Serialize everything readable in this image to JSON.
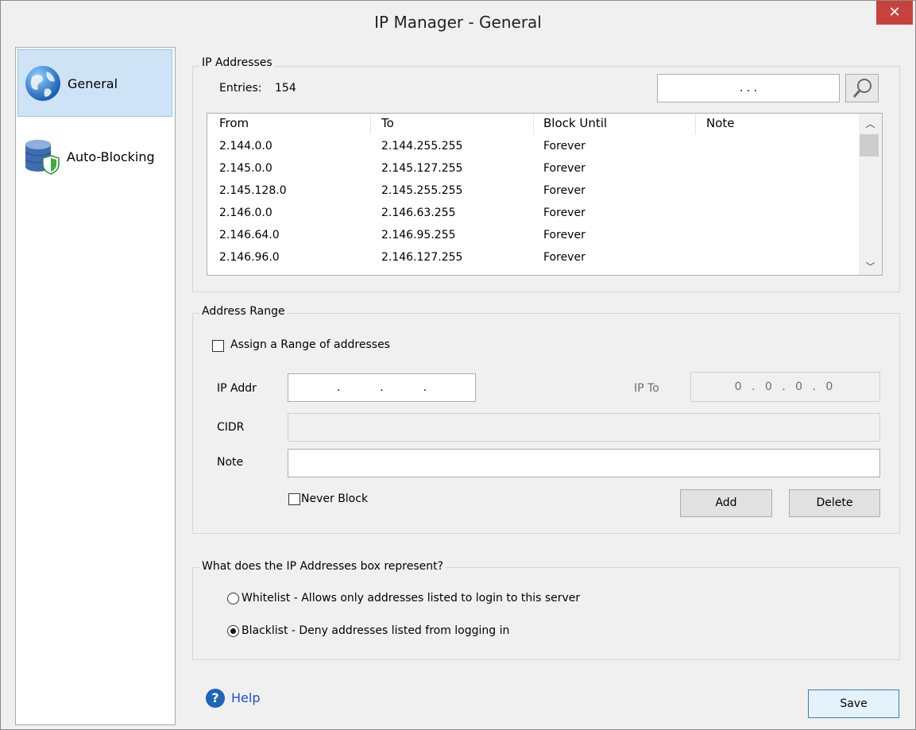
{
  "window": {
    "title": "IP Manager - General",
    "close_glyph": "✕"
  },
  "sidebar": {
    "items": [
      {
        "label": "General",
        "icon": "globe-icon",
        "active": true
      },
      {
        "label": "Auto-Blocking",
        "icon": "database-shield-icon",
        "active": false
      }
    ]
  },
  "ip_addresses": {
    "group_title": "IP Addresses",
    "entries_label": "Entries:",
    "entries_count": "154",
    "search_ip_placeholder": ". . .",
    "columns": [
      "From",
      "To",
      "Block Until",
      "Note"
    ],
    "rows": [
      {
        "from": "2.144.0.0",
        "to": "2.144.255.255",
        "until": "Forever",
        "note": ""
      },
      {
        "from": "2.145.0.0",
        "to": "2.145.127.255",
        "until": "Forever",
        "note": ""
      },
      {
        "from": "2.145.128.0",
        "to": "2.145.255.255",
        "until": "Forever",
        "note": ""
      },
      {
        "from": "2.146.0.0",
        "to": "2.146.63.255",
        "until": "Forever",
        "note": ""
      },
      {
        "from": "2.146.64.0",
        "to": "2.146.95.255",
        "until": "Forever",
        "note": ""
      },
      {
        "from": "2.146.96.0",
        "to": "2.146.127.255",
        "until": "Forever",
        "note": ""
      }
    ]
  },
  "address_range": {
    "group_title": "Address Range",
    "assign_range_label": "Assign a Range of addresses",
    "assign_range_checked": false,
    "ip_addr_label": "IP Addr",
    "ip_to_label": "IP To",
    "ip_to_value": "0 . 0 . 0 . 0",
    "cidr_label": "CIDR",
    "cidr_value": "",
    "note_label": "Note",
    "note_value": "",
    "never_block_label": "Never Block",
    "never_block_checked": false,
    "add_label": "Add",
    "delete_label": "Delete"
  },
  "representation": {
    "group_title": "What does the IP Addresses box represent?",
    "whitelist_label": "Whitelist - Allows only addresses listed to login to this server",
    "blacklist_label": "Blacklist - Deny addresses listed from logging in",
    "selected": "blacklist"
  },
  "footer": {
    "help_label": "Help",
    "save_label": "Save"
  },
  "colors": {
    "close_bg": "#c7423c",
    "active_item_bg": "#cfe3f7",
    "link": "#1d4fd6"
  }
}
